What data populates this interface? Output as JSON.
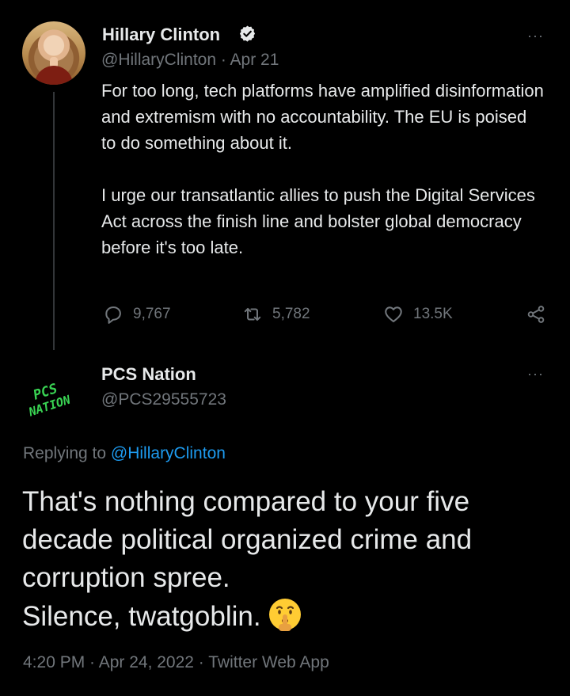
{
  "original_tweet": {
    "author_name": "Hillary Clinton",
    "handle_date": "@HillaryClinton · Apr 21",
    "paragraphs": [
      "For too long, tech platforms have amplified disinformation and extremism with no accountability. The EU is poised to do something about it.",
      "I urge our transatlantic allies to push the Digital Services Act across the finish line and bolster global democracy before it's too late."
    ],
    "more": "···",
    "actions": {
      "reply_count": "9,767",
      "retweet_count": "5,782",
      "like_count": "13.5K"
    }
  },
  "reply_tweet": {
    "author_name": "PCS Nation",
    "handle": "@PCS29555723",
    "more": "···",
    "replying_prefix": "Replying to ",
    "replying_mention": "@HillaryClinton",
    "text_line1": "That's nothing compared to your five",
    "text_line2": "decade political organized crime and",
    "text_line3": "corruption spree.",
    "text_line4": "Silence, twatgoblin.",
    "avatar_logo_text_1": "PCS",
    "avatar_logo_text_2": "NATION",
    "meta": "4:20 PM · Apr 24, 2022 · Twitter Web App"
  },
  "icons": {
    "reply": "reply-icon",
    "retweet": "retweet-icon",
    "like": "heart-icon",
    "share": "share-icon",
    "verified": "verified-badge-icon",
    "emoji": "shushing-face-emoji"
  },
  "colors": {
    "background": "#000000",
    "text": "#e7e9ea",
    "muted": "#71767b",
    "link": "#1d9bf0",
    "logo_green": "#39d353"
  }
}
